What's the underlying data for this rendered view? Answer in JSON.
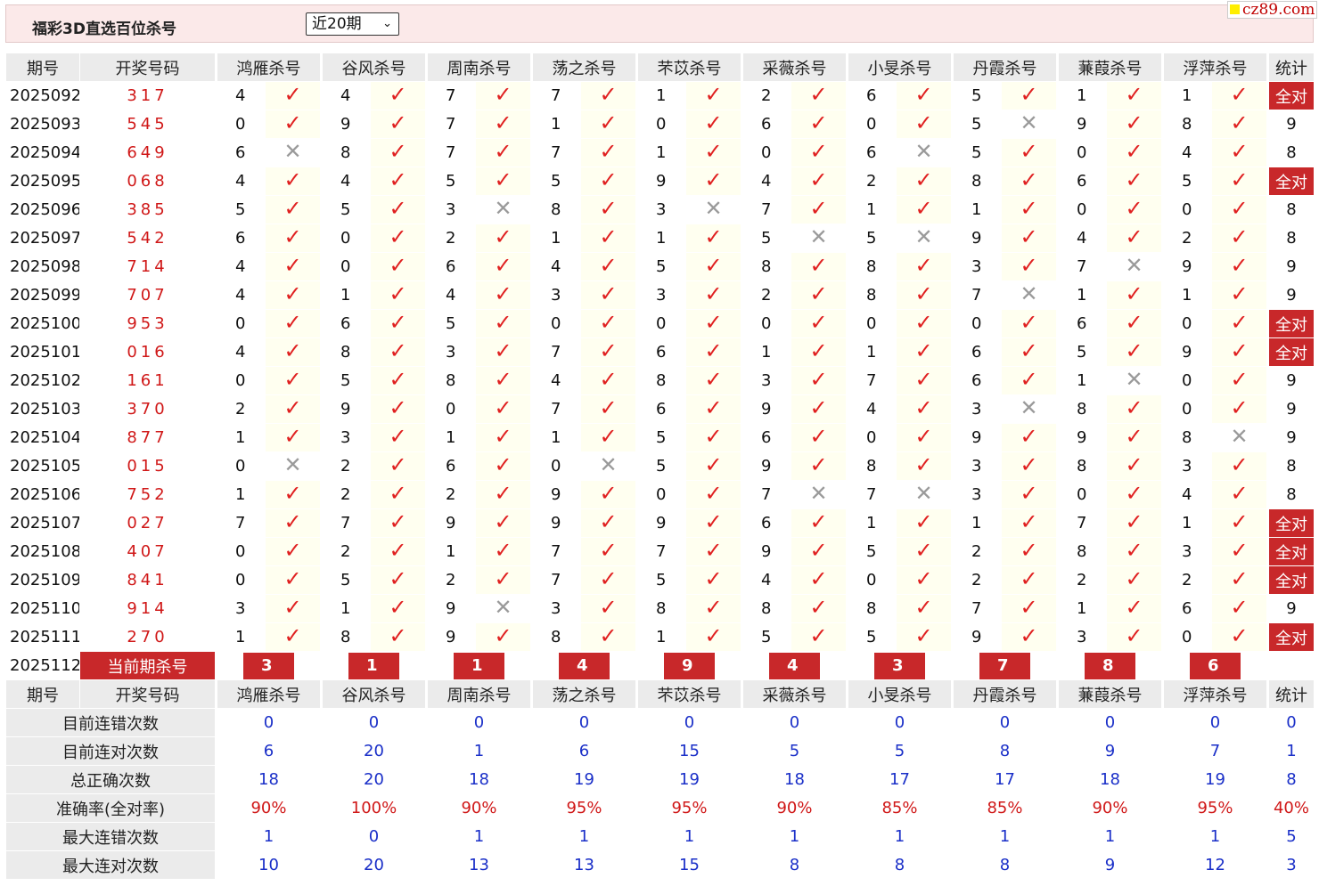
{
  "header": {
    "title": "福彩3D直选百位杀号",
    "period_select": "近20期",
    "site_logo": "cz89.com"
  },
  "columns": {
    "issue": "期号",
    "draw": "开奖号码",
    "experts": [
      "鸿雁杀号",
      "谷风杀号",
      "周南杀号",
      "荡之杀号",
      "芣苡杀号",
      "采薇杀号",
      "小旻杀号",
      "丹霞杀号",
      "蒹葭杀号",
      "浮萍杀号"
    ],
    "stat": "统计"
  },
  "rows": [
    {
      "issue": "2025092",
      "draw": "317",
      "kills": [
        4,
        4,
        7,
        7,
        1,
        2,
        6,
        5,
        1,
        1
      ],
      "ok": [
        1,
        1,
        1,
        1,
        1,
        1,
        1,
        1,
        1,
        1
      ],
      "stat": "全对"
    },
    {
      "issue": "2025093",
      "draw": "545",
      "kills": [
        0,
        9,
        7,
        1,
        0,
        6,
        0,
        5,
        9,
        8
      ],
      "ok": [
        1,
        1,
        1,
        1,
        1,
        1,
        1,
        0,
        1,
        1
      ],
      "stat": "9"
    },
    {
      "issue": "2025094",
      "draw": "649",
      "kills": [
        6,
        8,
        7,
        7,
        1,
        0,
        6,
        5,
        0,
        4
      ],
      "ok": [
        0,
        1,
        1,
        1,
        1,
        1,
        0,
        1,
        1,
        1
      ],
      "stat": "8"
    },
    {
      "issue": "2025095",
      "draw": "068",
      "kills": [
        4,
        4,
        5,
        5,
        9,
        4,
        2,
        8,
        6,
        5
      ],
      "ok": [
        1,
        1,
        1,
        1,
        1,
        1,
        1,
        1,
        1,
        1
      ],
      "stat": "全对"
    },
    {
      "issue": "2025096",
      "draw": "385",
      "kills": [
        5,
        5,
        3,
        8,
        3,
        7,
        1,
        1,
        0,
        0
      ],
      "ok": [
        1,
        1,
        0,
        1,
        0,
        1,
        1,
        1,
        1,
        1
      ],
      "stat": "8"
    },
    {
      "issue": "2025097",
      "draw": "542",
      "kills": [
        6,
        0,
        2,
        1,
        1,
        5,
        5,
        9,
        4,
        2
      ],
      "ok": [
        1,
        1,
        1,
        1,
        1,
        0,
        0,
        1,
        1,
        1
      ],
      "stat": "8"
    },
    {
      "issue": "2025098",
      "draw": "714",
      "kills": [
        4,
        0,
        6,
        4,
        5,
        8,
        8,
        3,
        7,
        9
      ],
      "ok": [
        1,
        1,
        1,
        1,
        1,
        1,
        1,
        1,
        0,
        1
      ],
      "stat": "9"
    },
    {
      "issue": "2025099",
      "draw": "707",
      "kills": [
        4,
        1,
        4,
        3,
        3,
        2,
        8,
        7,
        1,
        1
      ],
      "ok": [
        1,
        1,
        1,
        1,
        1,
        1,
        1,
        0,
        1,
        1
      ],
      "stat": "9"
    },
    {
      "issue": "2025100",
      "draw": "953",
      "kills": [
        0,
        6,
        5,
        0,
        0,
        0,
        0,
        0,
        6,
        0
      ],
      "ok": [
        1,
        1,
        1,
        1,
        1,
        1,
        1,
        1,
        1,
        1
      ],
      "stat": "全对"
    },
    {
      "issue": "2025101",
      "draw": "016",
      "kills": [
        4,
        8,
        3,
        7,
        6,
        1,
        1,
        6,
        5,
        9
      ],
      "ok": [
        1,
        1,
        1,
        1,
        1,
        1,
        1,
        1,
        1,
        1
      ],
      "stat": "全对"
    },
    {
      "issue": "2025102",
      "draw": "161",
      "kills": [
        0,
        5,
        8,
        4,
        8,
        3,
        7,
        6,
        1,
        0
      ],
      "ok": [
        1,
        1,
        1,
        1,
        1,
        1,
        1,
        1,
        0,
        1
      ],
      "stat": "9"
    },
    {
      "issue": "2025103",
      "draw": "370",
      "kills": [
        2,
        9,
        0,
        7,
        6,
        9,
        4,
        3,
        8,
        0
      ],
      "ok": [
        1,
        1,
        1,
        1,
        1,
        1,
        1,
        0,
        1,
        1
      ],
      "stat": "9"
    },
    {
      "issue": "2025104",
      "draw": "877",
      "kills": [
        1,
        3,
        1,
        1,
        5,
        6,
        0,
        9,
        9,
        8
      ],
      "ok": [
        1,
        1,
        1,
        1,
        1,
        1,
        1,
        1,
        1,
        0
      ],
      "stat": "9"
    },
    {
      "issue": "2025105",
      "draw": "015",
      "kills": [
        0,
        2,
        6,
        0,
        5,
        9,
        8,
        3,
        8,
        3
      ],
      "ok": [
        0,
        1,
        1,
        0,
        1,
        1,
        1,
        1,
        1,
        1
      ],
      "stat": "8"
    },
    {
      "issue": "2025106",
      "draw": "752",
      "kills": [
        1,
        2,
        2,
        9,
        0,
        7,
        7,
        3,
        0,
        4
      ],
      "ok": [
        1,
        1,
        1,
        1,
        1,
        0,
        0,
        1,
        1,
        1
      ],
      "stat": "8"
    },
    {
      "issue": "2025107",
      "draw": "027",
      "kills": [
        7,
        7,
        9,
        9,
        9,
        6,
        1,
        1,
        7,
        1
      ],
      "ok": [
        1,
        1,
        1,
        1,
        1,
        1,
        1,
        1,
        1,
        1
      ],
      "stat": "全对"
    },
    {
      "issue": "2025108",
      "draw": "407",
      "kills": [
        0,
        2,
        1,
        7,
        7,
        9,
        5,
        2,
        8,
        3
      ],
      "ok": [
        1,
        1,
        1,
        1,
        1,
        1,
        1,
        1,
        1,
        1
      ],
      "stat": "全对"
    },
    {
      "issue": "2025109",
      "draw": "841",
      "kills": [
        0,
        5,
        2,
        7,
        5,
        4,
        0,
        2,
        2,
        2
      ],
      "ok": [
        1,
        1,
        1,
        1,
        1,
        1,
        1,
        1,
        1,
        1
      ],
      "stat": "全对"
    },
    {
      "issue": "2025110",
      "draw": "914",
      "kills": [
        3,
        1,
        9,
        3,
        8,
        8,
        8,
        7,
        1,
        6
      ],
      "ok": [
        1,
        1,
        0,
        1,
        1,
        1,
        1,
        1,
        1,
        1
      ],
      "stat": "9"
    },
    {
      "issue": "2025111",
      "draw": "270",
      "kills": [
        1,
        8,
        9,
        8,
        1,
        5,
        5,
        9,
        3,
        0
      ],
      "ok": [
        1,
        1,
        1,
        1,
        1,
        1,
        1,
        1,
        1,
        1
      ],
      "stat": "全对"
    }
  ],
  "current": {
    "issue": "2025112",
    "label": "当前期杀号",
    "kills": [
      "3",
      "1",
      "1",
      "4",
      "9",
      "4",
      "3",
      "7",
      "8",
      "6"
    ]
  },
  "marks": {
    "ok": "✓",
    "ng": "✕"
  },
  "stats": [
    {
      "label": "目前连错次数",
      "values": [
        "0",
        "0",
        "0",
        "0",
        "0",
        "0",
        "0",
        "0",
        "0",
        "0"
      ],
      "total": "0"
    },
    {
      "label": "目前连对次数",
      "values": [
        "6",
        "20",
        "1",
        "6",
        "15",
        "5",
        "5",
        "8",
        "9",
        "7"
      ],
      "total": "1"
    },
    {
      "label": "总正确次数",
      "values": [
        "18",
        "20",
        "18",
        "19",
        "19",
        "18",
        "17",
        "17",
        "18",
        "19"
      ],
      "total": "8"
    },
    {
      "label": "准确率(全对率)",
      "values": [
        "90%",
        "100%",
        "90%",
        "95%",
        "95%",
        "90%",
        "85%",
        "85%",
        "90%",
        "95%"
      ],
      "total": "40%",
      "rate": true
    },
    {
      "label": "最大连错次数",
      "values": [
        "1",
        "0",
        "1",
        "1",
        "1",
        "1",
        "1",
        "1",
        "1",
        "1"
      ],
      "total": "5"
    },
    {
      "label": "最大连对次数",
      "values": [
        "10",
        "20",
        "13",
        "13",
        "15",
        "8",
        "8",
        "8",
        "9",
        "12"
      ],
      "total": "3"
    }
  ],
  "colors": {
    "accent_red": "#c8282a",
    "stat_blue": "#1a2fc8",
    "header_bg": "#fbe9e9"
  }
}
